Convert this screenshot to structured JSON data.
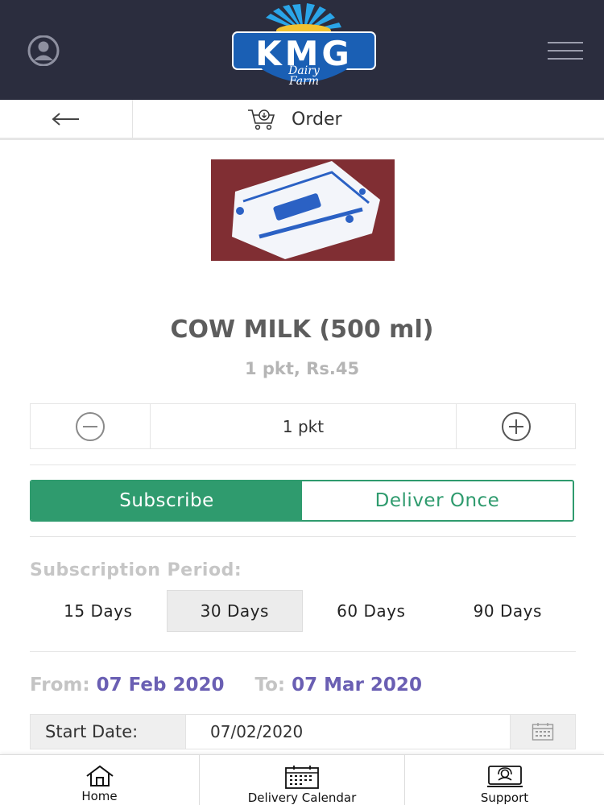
{
  "header": {
    "brand": "KMG",
    "brand_sub1": "Dairy",
    "brand_sub2": "Farm",
    "icons": [
      "user-avatar-icon",
      "hamburger-menu-icon"
    ]
  },
  "subheader": {
    "title": "Order",
    "icons": [
      "back-arrow-icon",
      "cart-icon"
    ]
  },
  "product": {
    "name": "COW MILK (500 ml)",
    "price_line": "1 pkt, Rs.45",
    "image": "milk-packet-photo"
  },
  "quantity": {
    "value": "1 pkt",
    "icons": [
      "minus-circle-icon",
      "plus-circle-icon"
    ]
  },
  "mode": {
    "subscribe_label": "Subscribe",
    "deliver_once_label": "Deliver Once",
    "selected": "Subscribe"
  },
  "subscription": {
    "label": "Subscription Period:",
    "periods": [
      "15 Days",
      "30 Days",
      "60 Days",
      "90 Days"
    ],
    "selected": "30 Days"
  },
  "range": {
    "from_label": "From:",
    "from_value": "07 Feb 2020",
    "to_label": "To:",
    "to_value": "07 Mar 2020"
  },
  "start_date": {
    "label": "Start Date:",
    "value": "07/02/2020"
  },
  "bottom_nav": {
    "items": [
      {
        "label": "Home",
        "icon": "home-icon"
      },
      {
        "label": "Delivery Calendar",
        "icon": "calendar-icon"
      },
      {
        "label": "Support",
        "icon": "support-icon"
      }
    ]
  },
  "colors": {
    "header_bg": "#2b2d3e",
    "accent_green": "#2f9b6e",
    "date_purple": "#6a5fb3",
    "brand_blue": "#1a5fb4"
  }
}
